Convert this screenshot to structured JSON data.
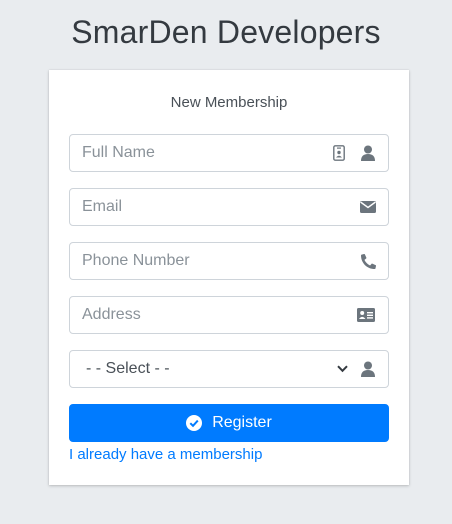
{
  "logo": {
    "text": "SmarDen Developers"
  },
  "card": {
    "title": "New Membership"
  },
  "fields": {
    "full_name": {
      "placeholder": "Full Name",
      "icons": [
        "id-badge-icon",
        "user-icon"
      ]
    },
    "email": {
      "placeholder": "Email",
      "icon": "envelope-icon"
    },
    "phone": {
      "placeholder": "Phone Number",
      "icon": "phone-icon"
    },
    "address": {
      "placeholder": "Address",
      "icon": "address-card-icon"
    },
    "select": {
      "value": "- - Select - -",
      "icons": [
        "chevron-down-icon",
        "user-icon"
      ]
    }
  },
  "register": {
    "label": "Register",
    "icon": "check-circle-icon"
  },
  "link": {
    "text": "I already have a membership"
  },
  "colors": {
    "primary": "#007bff",
    "background": "#e9ecef",
    "icon": "#6c757d"
  }
}
